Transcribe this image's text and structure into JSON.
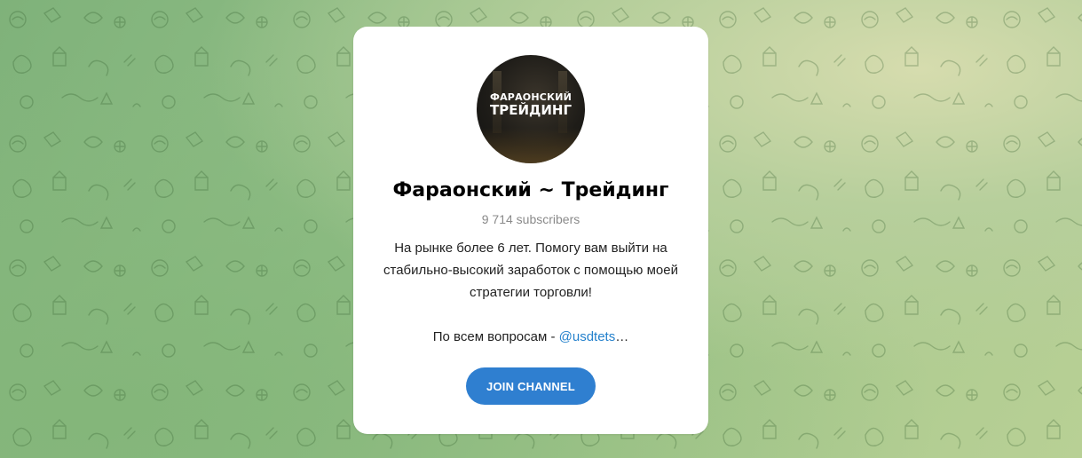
{
  "channel": {
    "avatar_text_line1": "ФАРАОНСКИЙ",
    "avatar_text_line2": "ТРЕЙДИНГ",
    "title": "Фараонский ~ Трейдинг",
    "subscribers": "9 714 subscribers",
    "description": "На рынке более 6 лет. Помогу вам выйти на стабильно-высокий заработок с помощью моей стратегии торговли!",
    "contact_prefix": "По всем вопросам - ",
    "contact_link": "@usdtets",
    "contact_suffix": "…"
  },
  "actions": {
    "join_label": "JOIN CHANNEL"
  },
  "colors": {
    "accent": "#2f7fd0",
    "link": "#2481cc",
    "muted": "#8a8a8a"
  }
}
